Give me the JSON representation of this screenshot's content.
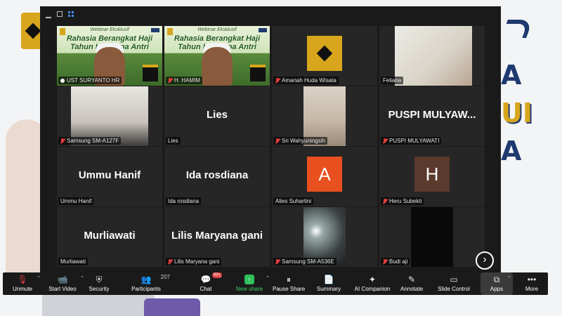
{
  "window": {
    "colors": {
      "active_border": "#9acd32",
      "mute_red": "#e03e3e",
      "new_share_green": "#2fbf5c"
    }
  },
  "tiles": [
    {
      "name": "UST SURYANTO HR",
      "kind": "webinar",
      "muted": false,
      "pinned": true,
      "active": true,
      "webinar_subtitle": "Webinar Eksklusif",
      "webinar_title": "Rahasia Berangkat Haji Tahun Ini Tanpa Antri"
    },
    {
      "name": "H. HAMIM",
      "kind": "webinar",
      "muted": true,
      "pinned": false,
      "webinar_subtitle": "Webinar Eksklusif",
      "webinar_title": "Rahasia Berangkat Haji Tahun Ini Tanpa Antri"
    },
    {
      "name": "Amanah Huda Wisata",
      "kind": "logo",
      "muted": true
    },
    {
      "name": "Feliana",
      "kind": "video",
      "muted": false
    },
    {
      "name": "Samsung SM-A127F",
      "kind": "video",
      "muted": true
    },
    {
      "name": "Lies",
      "kind": "name",
      "display": "Lies",
      "muted": false
    },
    {
      "name": "Sri Wahyuningsih",
      "kind": "video",
      "muted": true
    },
    {
      "name": "PUSPI MULYAWATI",
      "kind": "name",
      "display": "PUSPI  MULYAW...",
      "muted": true
    },
    {
      "name": "Ummu Hanif",
      "kind": "name",
      "display": "Ummu Hanif",
      "muted": false
    },
    {
      "name": "Ida rosdiana",
      "kind": "name",
      "display": "Ida rosdiana",
      "muted": false
    },
    {
      "name": "Alies Suhartini",
      "kind": "avatar",
      "letter": "A",
      "color": "#e8501f",
      "muted": false
    },
    {
      "name": "Heru Subekti",
      "kind": "avatar",
      "letter": "H",
      "color": "#5b3a2e",
      "muted": true
    },
    {
      "name": "Murliawati",
      "kind": "name",
      "display": "Murliawati",
      "muted": false
    },
    {
      "name": "Lilis Maryana gani",
      "kind": "name",
      "display": "Lilis Maryana gani",
      "muted": true
    },
    {
      "name": "Samsung SM-A536E",
      "kind": "video",
      "muted": true
    },
    {
      "name": "Budi aji",
      "kind": "video",
      "muted": true
    }
  ],
  "toolbar": {
    "unmute": "Unmute",
    "start_video": "Start Video",
    "security": "Security",
    "participants": "Participants",
    "participants_count": "207",
    "chat": "Chat",
    "chat_badge": "99+",
    "new_share": "New share",
    "pause_share": "Pause Share",
    "summary": "Summary",
    "ai_companion": "AI Companion",
    "annotate": "Annotate",
    "slide_control": "Slide Control",
    "apps": "Apps",
    "more": "More"
  },
  "background": {
    "big_letters": [
      "A",
      "UI",
      "A"
    ]
  }
}
